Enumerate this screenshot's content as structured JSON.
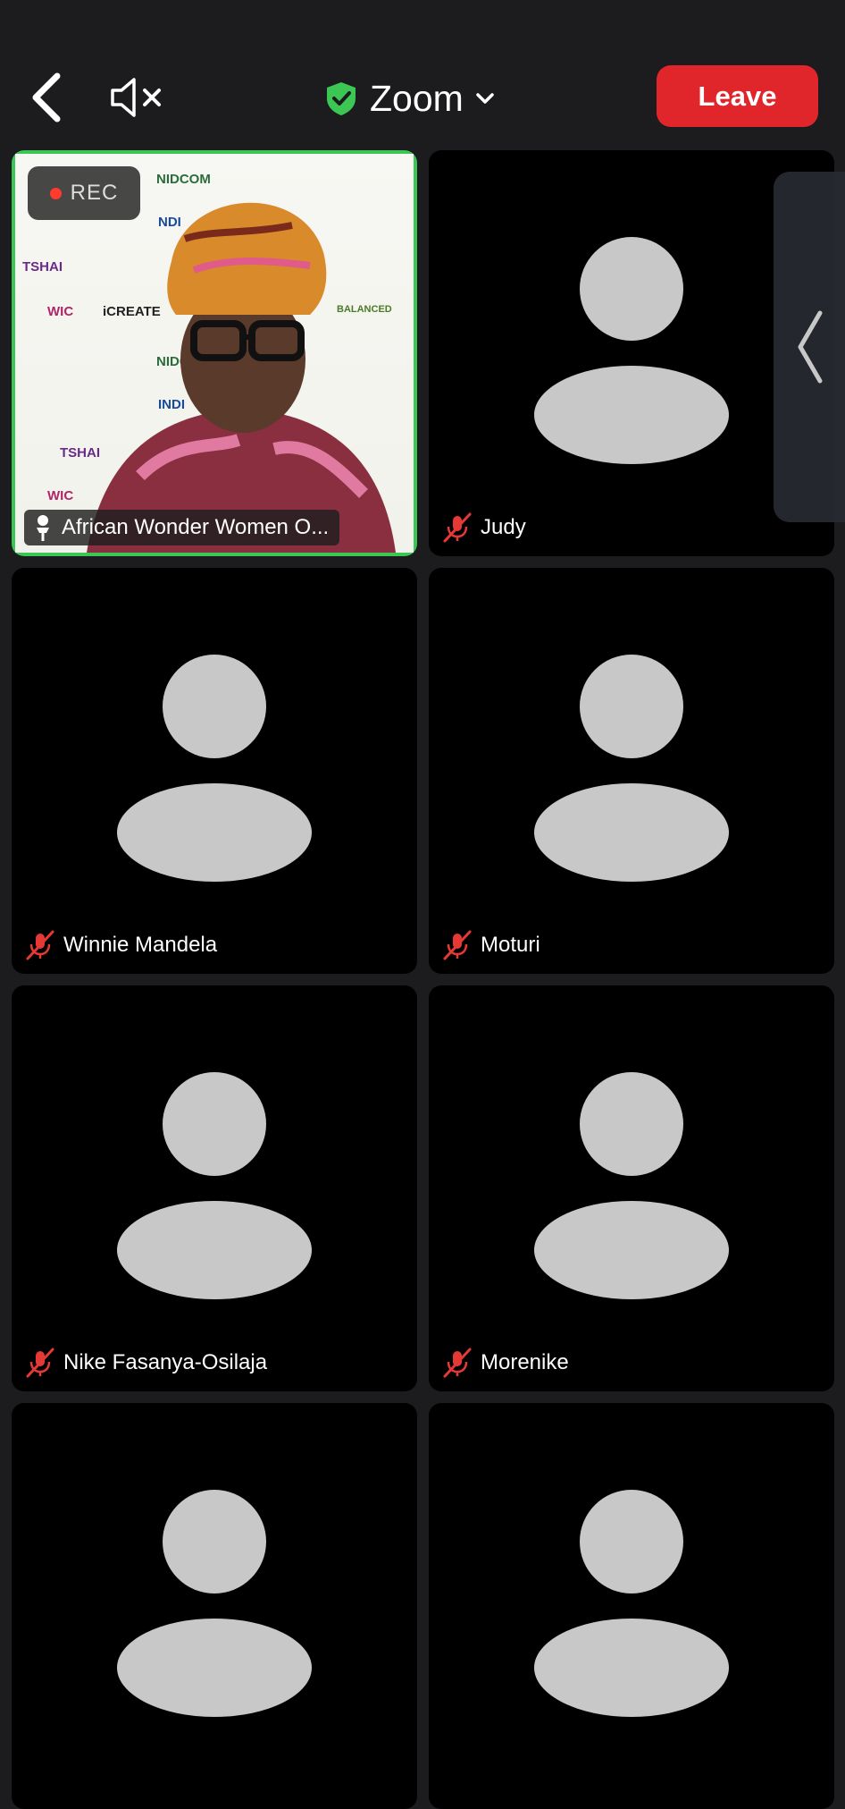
{
  "app": {
    "title": "Zoom",
    "leave_label": "Leave",
    "rec_label": "REC"
  },
  "icons": {
    "back": "chevron-left-icon",
    "speaker": "speaker-muted-icon",
    "shield": "shield-check-icon",
    "dropdown": "chevron-down-icon",
    "side": "chevron-left-icon"
  },
  "colors": {
    "leave": "#e0262a",
    "active_border": "#3cc653",
    "muted": "#e53935",
    "avatar": "#c8c8c8"
  },
  "participants": [
    {
      "name": "African Wonder Women O...",
      "muted": false,
      "active": true,
      "video": true
    },
    {
      "name": "Judy",
      "muted": true
    },
    {
      "name": "Winnie Mandela",
      "muted": true
    },
    {
      "name": "Moturi",
      "muted": true
    },
    {
      "name": "Nike Fasanya-Osilaja",
      "muted": true
    },
    {
      "name": "Morenike",
      "muted": true
    },
    {
      "name": "",
      "muted": false
    },
    {
      "name": "",
      "muted": false
    }
  ]
}
